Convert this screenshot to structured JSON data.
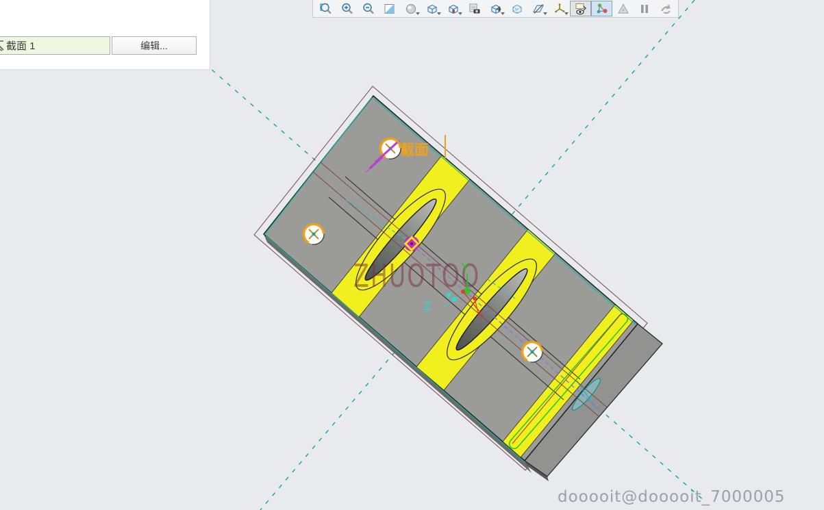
{
  "panel": {
    "section_field_value": "截面 1",
    "edit_button_label": "编辑..."
  },
  "toolbar": {
    "icons": [
      {
        "name": "zoom-window",
        "pressed": false,
        "disabled": false,
        "caret": false
      },
      {
        "name": "zoom-in",
        "pressed": false,
        "disabled": false,
        "caret": false
      },
      {
        "name": "zoom-out",
        "pressed": false,
        "disabled": false,
        "caret": false
      },
      {
        "name": "repaint",
        "pressed": false,
        "disabled": false,
        "caret": false
      },
      {
        "name": "shaded-display",
        "pressed": false,
        "disabled": false,
        "caret": true
      },
      {
        "name": "display-style-cube",
        "pressed": false,
        "disabled": false,
        "caret": true
      },
      {
        "name": "saved-views-cube",
        "pressed": false,
        "disabled": false,
        "caret": true
      },
      {
        "name": "view-manager-camera",
        "pressed": false,
        "disabled": false,
        "caret": false
      },
      {
        "name": "section-cube",
        "pressed": false,
        "disabled": false,
        "caret": true
      },
      {
        "name": "transparent-cube",
        "pressed": false,
        "disabled": false,
        "caret": false
      },
      {
        "name": "datum-plane-display",
        "pressed": false,
        "disabled": false,
        "caret": true
      },
      {
        "name": "datum-axis-display",
        "pressed": false,
        "disabled": false,
        "caret": true
      },
      {
        "name": "annotation-display",
        "pressed": true,
        "disabled": false,
        "caret": false
      },
      {
        "name": "datum-graph-display",
        "pressed": true,
        "pressedBlue": true,
        "disabled": false,
        "caret": false
      },
      {
        "name": "spin-center",
        "pressed": false,
        "disabled": false,
        "caret": false
      },
      {
        "name": "pause",
        "pressed": false,
        "disabled": false,
        "caret": false
      },
      {
        "name": "previous-view-arrow",
        "pressed": false,
        "disabled": true,
        "caret": false
      }
    ]
  },
  "viewport": {
    "section_label": "截面",
    "axis_y_label": "Y",
    "axis_z_label": "Z",
    "watermark_text": "ZHUOTOO",
    "account_text": "dooooit@dooooit_7000005"
  },
  "colors": {
    "background": "#e8eaee",
    "plate_gray": "#9b9b98",
    "side_gray": "#6b6b69",
    "stripe_yellow": "#f1ef1d",
    "datum_teal": "#0aa596",
    "section_maroon": "#7c4650",
    "marker_orange": "#efa11c",
    "handle_magenta": "#c32ac3",
    "arrow_magenta": "#b743cf",
    "green_edge": "#17c417",
    "purple_trace": "#7b78d8",
    "watermark_maroon": "#7c2e3e",
    "account_gray": "#9aa1a8"
  }
}
